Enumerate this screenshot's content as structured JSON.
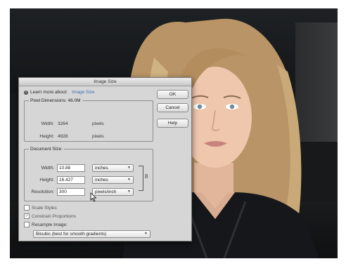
{
  "dialog": {
    "title": "Image Size",
    "learn_prefix": "Learn more about:",
    "learn_link": "Image Size",
    "buttons": {
      "ok": "OK",
      "cancel": "Cancel",
      "help": "Help"
    },
    "pixel_dimensions": {
      "legend": "Pixel Dimensions: 46.0M",
      "width_label": "Width:",
      "width_value": "3264",
      "width_unit": "pixels",
      "height_label": "Height:",
      "height_value": "4928",
      "height_unit": "pixels"
    },
    "document_size": {
      "legend": "Document Size:",
      "width_label": "Width:",
      "width_value": "10.88",
      "width_unit": "inches",
      "height_label": "Height:",
      "height_value": "16.427",
      "height_unit": "inches",
      "resolution_label": "Resolution:",
      "resolution_value": "300",
      "resolution_unit": "pixels/inch"
    },
    "options": {
      "scale_styles": "Scale Styles",
      "constrain": "Constrain Proportions",
      "resample": "Resample Image:",
      "resample_method": "Bicubic (best for smooth gradients)"
    }
  }
}
